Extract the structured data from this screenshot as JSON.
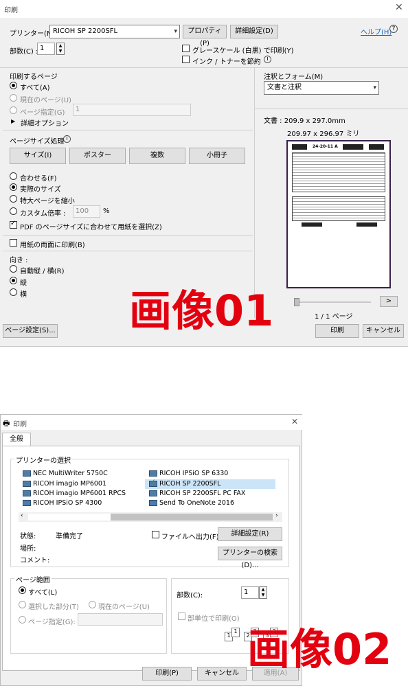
{
  "dialog1": {
    "title": "印刷",
    "close_icon": "close-icon",
    "printer_label": "プリンター(N) :",
    "printer_value": "RICOH SP 2200SFL",
    "properties_button": "プロパティ(P)",
    "advanced_button": "詳細設定(D)",
    "help_link": "ヘルプ(H)",
    "copies_label": "部数(C) :",
    "copies_value": "1",
    "grayscale_label": "グレースケール (白黒) で印刷(Y)",
    "ink_saver_label": "インク / トナーを節約",
    "pages_group_title": "印刷するページ",
    "all_label": "すべて(A)",
    "current_page_label": "現在のページ(U)",
    "page_range_label": "ページ指定(G)",
    "page_range_value": "1",
    "more_options_label": "詳細オプション",
    "page_sizing_title": "ページサイズ処理",
    "size_button": "サイズ(I)",
    "poster_button": "ポスター",
    "multiple_button": "複数",
    "booklet_button": "小冊子",
    "fit_label": "合わせる(F)",
    "actual_size_label": "実際のサイズ",
    "shrink_label": "特大ページを縮小",
    "custom_scale_label": "カスタム倍率 :",
    "custom_scale_value": "100",
    "percent": "%",
    "pdf_paper_label": "PDF のページサイズに合わせて用紙を選択(Z)",
    "duplex_label": "用紙の両面に印刷(B)",
    "orientation_label": "向き :",
    "auto_orient_label": "自動縦 / 横(R)",
    "portrait_label": "縦",
    "landscape_label": "横",
    "comments_forms_label": "注釈とフォーム(M)",
    "comments_forms_value": "文書と注釈",
    "document_size": "文書 : 209.9 x 297.0mm",
    "paper_size": "209.97 x 296.97 ミリ",
    "page_count": "1 / 1 ページ",
    "next_button": ">",
    "page_setup_button": "ページ設定(S)...",
    "print_button": "印刷",
    "cancel_button": "キャンセル",
    "watermark": "画像01",
    "preview_header": "24-20-11 A"
  },
  "dialog2": {
    "title": "印刷",
    "tab_general": "全般",
    "select_printer_title": "プリンターの選択",
    "printers": [
      {
        "name": "NEC MultiWriter 5750C",
        "selected": false
      },
      {
        "name": "RICOH IPSiO SP 6330",
        "selected": false
      },
      {
        "name": "RICOH imagio MP6001",
        "selected": false
      },
      {
        "name": "RICOH SP 2200SFL",
        "selected": true
      },
      {
        "name": "RICOH imagio MP6001 RPCS",
        "selected": false
      },
      {
        "name": "RICOH SP 2200SFL PC FAX",
        "selected": false
      },
      {
        "name": "RICOH IPSiO SP 4300",
        "selected": false
      },
      {
        "name": "Send To OneNote 2016",
        "selected": false
      }
    ],
    "status_label": "状態:",
    "status_value": "準備完了",
    "location_label": "場所:",
    "comment_label": "コメント:",
    "print_to_file_label": "ファイルへ出力(F)",
    "preferences_button": "詳細設定(R)",
    "find_printer_button": "プリンターの検索(D)...",
    "page_range_title": "ページ範囲",
    "all_label": "すべて(L)",
    "selection_label": "選択した部分(T)",
    "current_page_label": "現在のページ(U)",
    "pages_label": "ページ指定(G):",
    "copies_label": "部数(C):",
    "copies_value": "1",
    "collate_label": "部単位で印刷(O)",
    "print_button": "印刷(P)",
    "cancel_button": "キャンセル",
    "apply_button": "適用(A)",
    "watermark": "画像02"
  },
  "colors": {
    "watermark": "#e3000f",
    "link": "#0066cc",
    "selection": "#cce4f7"
  }
}
